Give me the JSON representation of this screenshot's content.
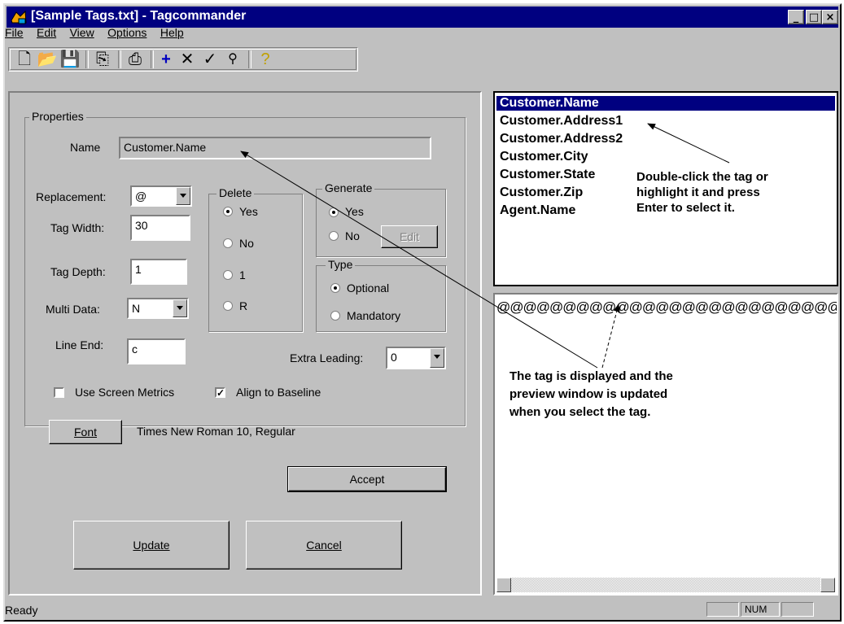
{
  "window": {
    "title": "[Sample Tags.txt] - Tagcommander"
  },
  "menu": {
    "items": [
      "File",
      "Edit",
      "View",
      "Options",
      "Help"
    ]
  },
  "toolbar": {
    "icons": [
      "new-file-icon",
      "open-folder-icon",
      "save-icon",
      "copy-icon",
      "print-icon",
      "add-icon",
      "delete-icon",
      "checkmark-icon",
      "search-icon",
      "help-icon"
    ]
  },
  "properties": {
    "legend": "Properties",
    "name_label": "Name",
    "name_value": "Customer.Name",
    "replacement_label": "Replacement:",
    "replacement_value": "@",
    "tag_width_label": "Tag Width:",
    "tag_width_value": "30",
    "tag_depth_label": "Tag Depth:",
    "tag_depth_value": "1",
    "multi_data_label": "Multi Data:",
    "multi_data_value": "N",
    "line_end_label": "Line End:",
    "line_end_value": "c",
    "delete": {
      "legend": "Delete",
      "options": [
        "Yes",
        "No",
        "1",
        "R"
      ],
      "selected": "Yes"
    },
    "generate": {
      "legend": "Generate",
      "options": [
        "Yes",
        "No"
      ],
      "selected": "Yes",
      "edit_label": "Edit"
    },
    "type": {
      "legend": "Type",
      "options": [
        "Optional",
        "Mandatory"
      ],
      "selected": "Optional"
    },
    "extra_leading_label": "Extra Leading:",
    "extra_leading_value": "0",
    "use_screen_metrics_label": "Use Screen Metrics",
    "use_screen_metrics_checked": false,
    "align_baseline_label": "Align to Baseline",
    "align_baseline_checked": true,
    "font_button": "Font",
    "font_value": "Times New Roman 10, Regular"
  },
  "buttons": {
    "accept": "Accept",
    "update": "Update",
    "cancel": "Cancel"
  },
  "tag_list": {
    "items": [
      "Customer.Name",
      "Customer.Address1",
      "Customer.Address2",
      "Customer.City",
      "Customer.State",
      "Customer.Zip",
      "Agent.Name"
    ],
    "selected_index": 0
  },
  "annotations": {
    "list_note": [
      "Double-click the tag or",
      "highlight it and press",
      "Enter to select it."
    ],
    "preview_note": [
      "The tag is displayed and the",
      "preview window is updated",
      "when you select the tag."
    ]
  },
  "preview": {
    "text": "@@@@@@@@@@@@@@@@@@@@@@@@@@@@@@"
  },
  "status": {
    "text": "Ready",
    "num": "NUM"
  }
}
